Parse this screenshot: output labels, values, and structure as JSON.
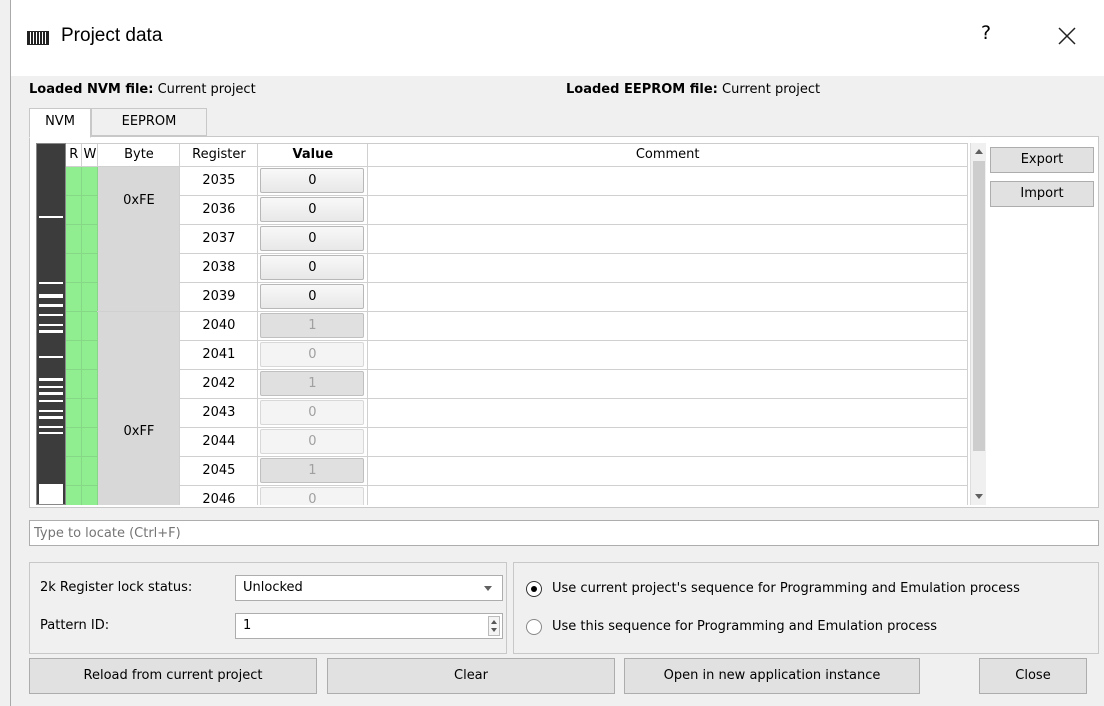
{
  "window": {
    "title": "Project data",
    "help_label": "?"
  },
  "header": {
    "nvm_label": "Loaded NVM file:",
    "nvm_value": "Current project",
    "eeprom_label": "Loaded EEPROM file:",
    "eeprom_value": "Current project"
  },
  "tabs": [
    {
      "label": "NVM",
      "active": true
    },
    {
      "label": "EEPROM",
      "active": false
    }
  ],
  "table": {
    "columns": [
      "R",
      "W",
      "Byte",
      "Register",
      "Value",
      "Comment"
    ],
    "groups": [
      {
        "byte": "0xFE",
        "rows": [
          {
            "register": "2035",
            "value": "0",
            "enabled": true
          },
          {
            "register": "2036",
            "value": "0",
            "enabled": true
          },
          {
            "register": "2037",
            "value": "0",
            "enabled": true
          },
          {
            "register": "2038",
            "value": "0",
            "enabled": true
          },
          {
            "register": "2039",
            "value": "0",
            "enabled": true
          }
        ]
      },
      {
        "byte": "0xFF",
        "rows": [
          {
            "register": "2040",
            "value": "1",
            "enabled": false
          },
          {
            "register": "2041",
            "value": "0",
            "enabled": false
          },
          {
            "register": "2042",
            "value": "1",
            "enabled": false
          },
          {
            "register": "2043",
            "value": "0",
            "enabled": false
          },
          {
            "register": "2044",
            "value": "0",
            "enabled": false
          },
          {
            "register": "2045",
            "value": "1",
            "enabled": false
          },
          {
            "register": "2046",
            "value": "0",
            "enabled": false
          }
        ]
      }
    ]
  },
  "side_buttons": {
    "export": "Export",
    "import": "Import"
  },
  "search": {
    "placeholder": "Type to locate (Ctrl+F)"
  },
  "lock": {
    "label": "2k Register lock status:",
    "value": "Unlocked"
  },
  "pattern": {
    "label": "Pattern ID:",
    "value": "1"
  },
  "radios": [
    {
      "label": "Use current project's sequence for Programming and Emulation process",
      "checked": true
    },
    {
      "label": "Use this sequence for Programming and Emulation process",
      "checked": false
    }
  ],
  "bottom_buttons": {
    "reload": "Reload from current project",
    "clear": "Clear",
    "open_new": "Open in new application instance",
    "close": "Close"
  }
}
